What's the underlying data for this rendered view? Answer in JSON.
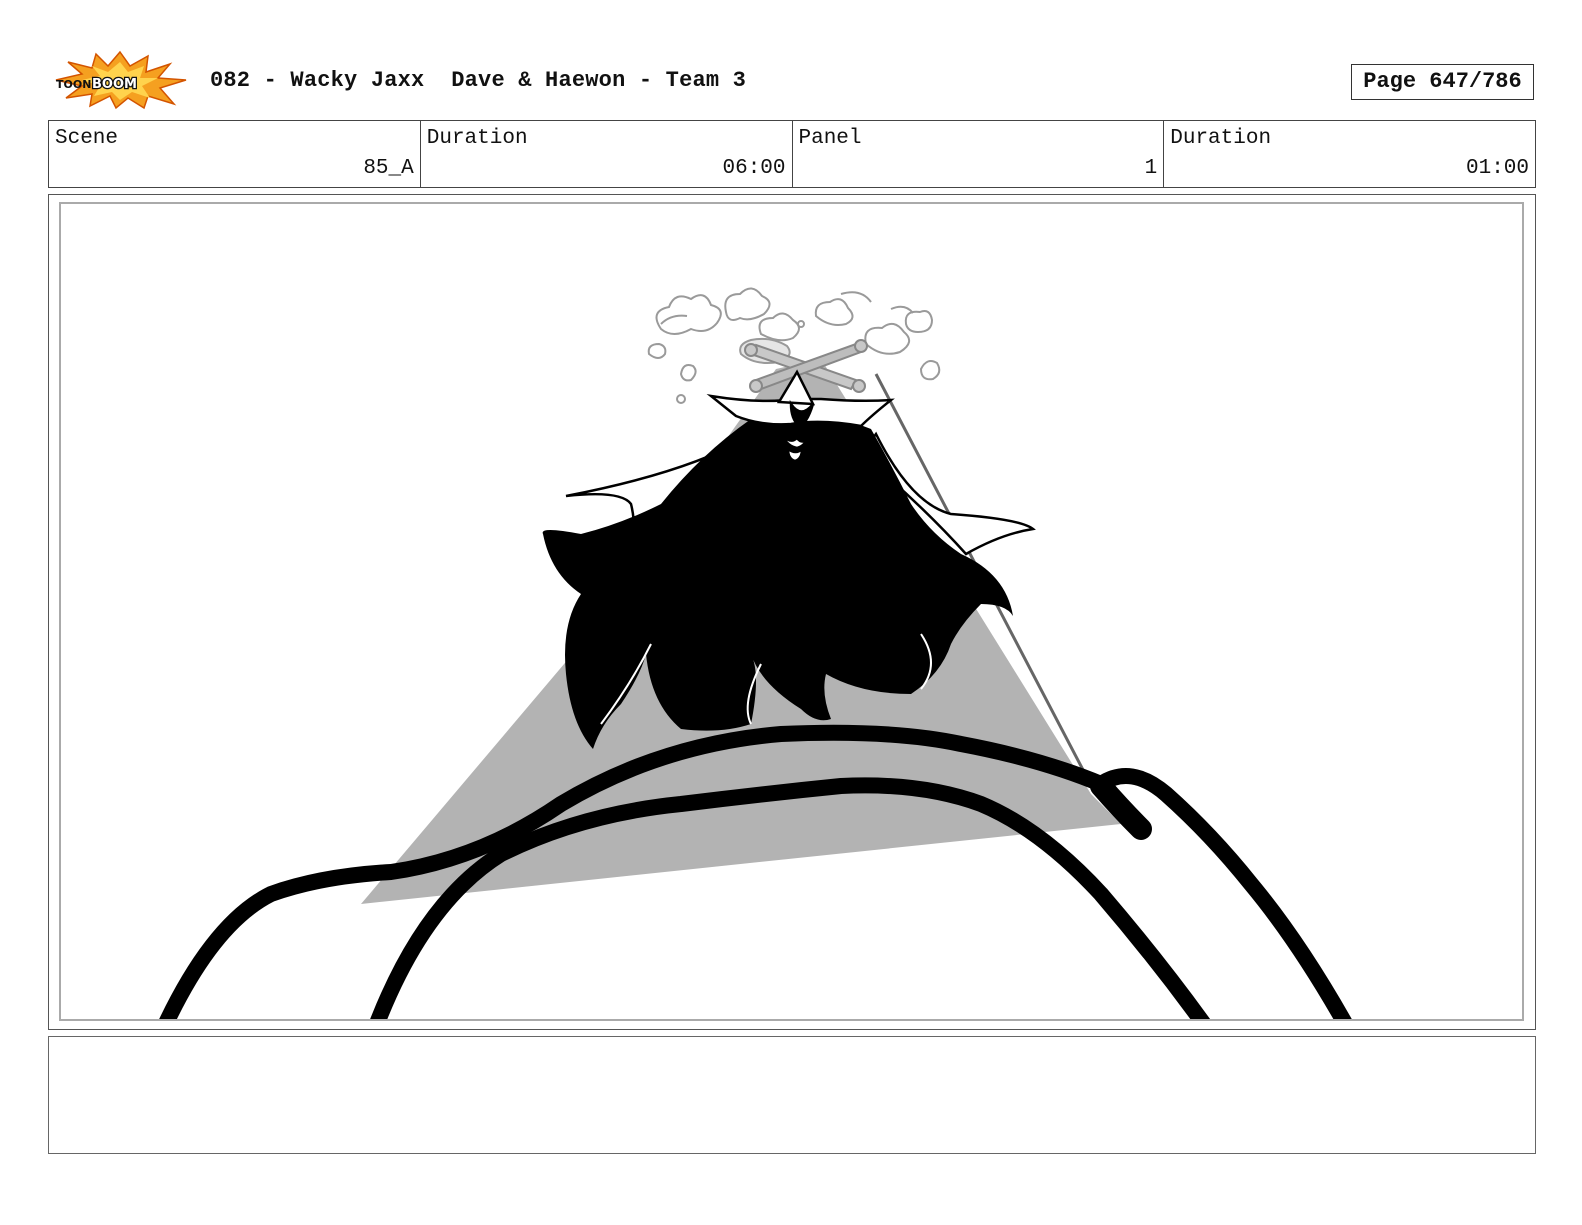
{
  "header": {
    "logo_text": "TOON BOOM",
    "title": "082 - Wacky Jaxx  Dave & Haewon - Team 3",
    "page": "Page 647/786"
  },
  "info": {
    "scene_label": "Scene",
    "scene_value": "85_A",
    "scene_duration_label": "Duration",
    "scene_duration_value": "06:00",
    "panel_label": "Panel",
    "panel_value": "1",
    "panel_duration_label": "Duration",
    "panel_duration_value": "01:00"
  },
  "panel": {
    "colors": {
      "ink": "#000000",
      "shadow": "#b0b0b0",
      "smoke": "#9a9a9a"
    }
  },
  "notes": {
    "text": ""
  }
}
